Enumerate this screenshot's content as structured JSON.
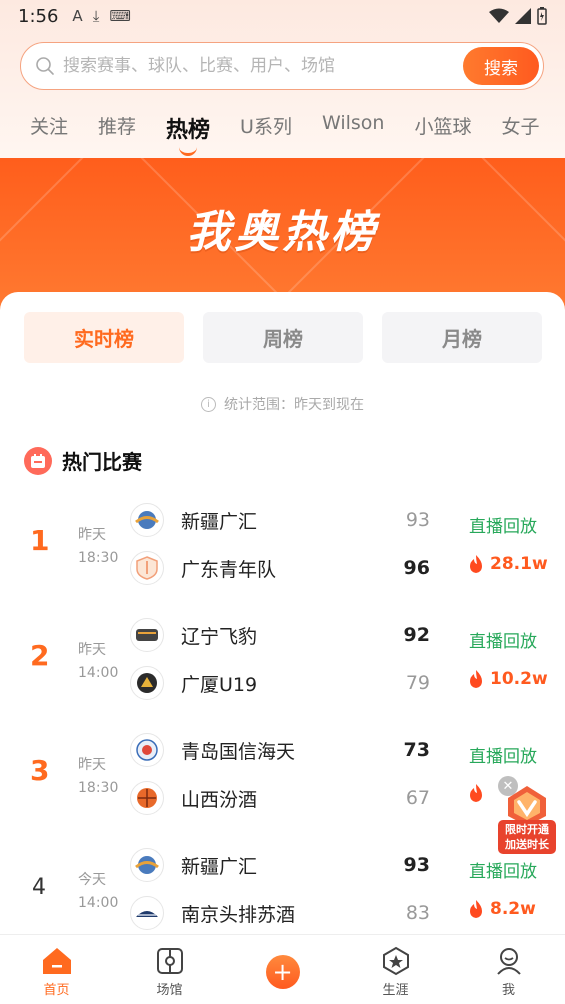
{
  "status_bar": {
    "time": "1:56",
    "icons": [
      "A",
      "⤓",
      "⌨"
    ]
  },
  "search": {
    "placeholder": "搜索赛事、球队、比赛、用户、场馆",
    "button_label": "搜索"
  },
  "tabs": [
    {
      "label": "关注"
    },
    {
      "label": "推荐"
    },
    {
      "label": "热榜"
    },
    {
      "label": "U系列"
    },
    {
      "label": "Wilson"
    },
    {
      "label": "小篮球"
    },
    {
      "label": "女子"
    }
  ],
  "active_tab": "热榜",
  "banner": {
    "title": "我奥热榜"
  },
  "rank_tabs": [
    {
      "label": "实时榜"
    },
    {
      "label": "周榜"
    },
    {
      "label": "月榜"
    }
  ],
  "stat_range": "统计范围：昨天到现在",
  "section": {
    "title": "热门比赛"
  },
  "games": [
    {
      "rank": "1",
      "day": "昨天",
      "time": "18:30",
      "team1": {
        "name": "新疆广汇",
        "score": "93"
      },
      "team2": {
        "name": "广东青年队",
        "score": "96"
      },
      "replay": "直播回放",
      "heat": "28.1w"
    },
    {
      "rank": "2",
      "day": "昨天",
      "time": "14:00",
      "team1": {
        "name": "辽宁飞豹",
        "score": "92"
      },
      "team2": {
        "name": "广厦U19",
        "score": "79"
      },
      "replay": "直播回放",
      "heat": "10.2w"
    },
    {
      "rank": "3",
      "day": "昨天",
      "time": "18:30",
      "team1": {
        "name": "青岛国信海天",
        "score": "73"
      },
      "team2": {
        "name": "山西汾酒",
        "score": "67"
      },
      "replay": "直播回放",
      "heat": ""
    },
    {
      "rank": "4",
      "day": "今天",
      "time": "14:00",
      "team1": {
        "name": "新疆广汇",
        "score": "93"
      },
      "team2": {
        "name": "南京头排苏酒",
        "score": "83"
      },
      "replay": "直播回放",
      "heat": "8.2w"
    }
  ],
  "promo": {
    "line1": "限时开通",
    "line2": "加送时长"
  },
  "bottom_nav": [
    {
      "label": "首页"
    },
    {
      "label": "场馆"
    },
    {
      "label": ""
    },
    {
      "label": "生涯"
    },
    {
      "label": "我"
    }
  ],
  "colors": {
    "accent": "#ff6a1f",
    "replay_green": "#27a85a",
    "banner": "#ff5e1c"
  }
}
